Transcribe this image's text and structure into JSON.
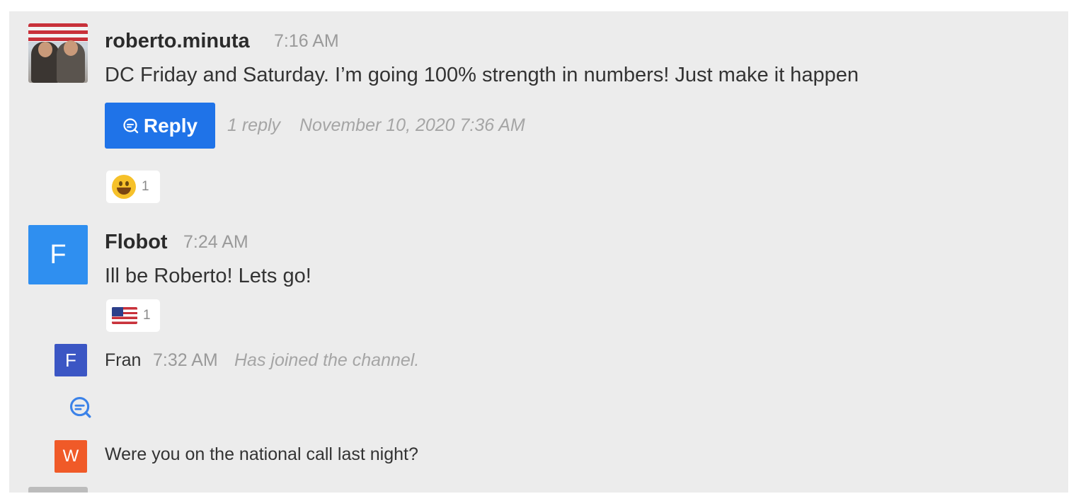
{
  "messages": [
    {
      "user": "roberto.minuta",
      "time": "7:16 AM",
      "text": "DC Friday and Saturday. I’m going 100% strength in numbers! Just make it happen",
      "reply_button_label": "Reply",
      "reply_count": "1 reply",
      "reply_date": "November 10, 2020 7:36 AM",
      "reaction": {
        "icon": "grinning-face-emoji",
        "count": "1"
      }
    },
    {
      "user": "Flobot",
      "avatar_letter": "F",
      "time": "7:24 AM",
      "text": "Ill be Roberto! Lets go!",
      "reaction": {
        "icon": "us-flag-emoji",
        "count": "1"
      }
    }
  ],
  "system_message": {
    "user": "Fran",
    "avatar_letter": "F",
    "time": "7:32 AM",
    "text": "Has joined the channel."
  },
  "thread_message": {
    "avatar_letter": "W",
    "text": "Were you on the national call last night?"
  },
  "colors": {
    "panel_bg": "#ececec",
    "reply_button": "#1f73e8",
    "flobot_avatar": "#2f8ff0",
    "fran_avatar": "#3b56c4",
    "w_avatar": "#f05a28"
  }
}
